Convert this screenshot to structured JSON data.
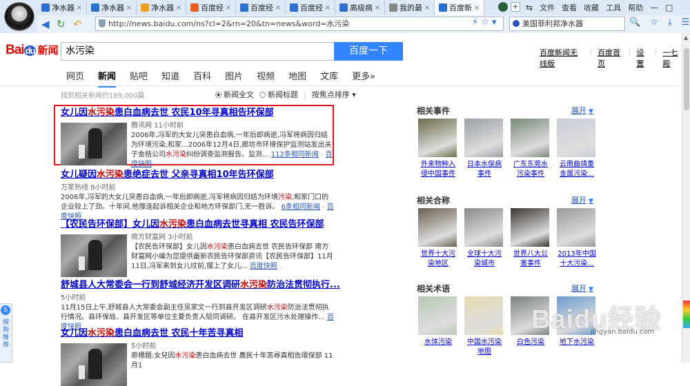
{
  "browser": {
    "tabs": [
      {
        "label": "净水器",
        "color": "#2a6fcf",
        "active": false
      },
      {
        "label": "净水器",
        "color": "#2a6fcf",
        "active": false
      },
      {
        "label": "净水器",
        "color": "#f0a020",
        "active": false
      },
      {
        "label": "百度经",
        "color": "#e85d23",
        "active": false
      },
      {
        "label": "百度经",
        "color": "#2a6fcf",
        "active": false
      },
      {
        "label": "百度经",
        "color": "#2a6fcf",
        "active": false
      },
      {
        "label": "高级病",
        "color": "#2a6fcf",
        "active": false
      },
      {
        "label": "我的最",
        "color": "#888888",
        "active": false
      },
      {
        "label": "百度新",
        "color": "#2a6fcf",
        "active": true
      }
    ],
    "menus": [
      "文件",
      "查看",
      "收藏",
      "工具",
      "帮助"
    ],
    "url": "http://news.baidu.com/ns?cl=2&rn=20&tn=news&word=水污染",
    "search_value": "美国菲利邦净水器"
  },
  "baidu": {
    "logo_main": "Bai",
    "logo_du": "du",
    "logo_news": "新闻",
    "query": "水污染",
    "search_button": "百度一下",
    "top_links": [
      "百度新闻无线版",
      "百度首页",
      "设置",
      "一七殿"
    ],
    "tabs": [
      "网页",
      "新闻",
      "贴吧",
      "知道",
      "百科",
      "图片",
      "视频",
      "地图",
      "文库",
      "更多»"
    ],
    "selected_tab": "新闻",
    "result_count": "找到相关新闻约189,000篇",
    "sort": {
      "fulltext": "新闻全文",
      "title": "新闻标题",
      "by_time": "按焦点排序"
    }
  },
  "results": [
    {
      "title_pre": "女儿因",
      "title_hl": "水污染",
      "title_post": "患白血病去世 农民10年寻真相告环保部",
      "source": "腾讯网  11小时前",
      "body": "2006年,冯军的大女儿突患白血病,一年后即病逝,冯军将病因归结为环境污染,和家...2006年12月4日,廊坊市环境保护监测站发出关于金桔公司",
      "body_hl": "水污染",
      "body_tail": "纠纷调查监测报告。监测...",
      "more": "112条相同新闻",
      "cache": "百度快照"
    },
    {
      "title_pre": "女儿疑因",
      "title_hl": "水污染",
      "title_post": "患绝症去世 父亲寻真相10年告环保部",
      "source": "万家热线  8小时前",
      "body": "2006年,冯军的大女儿突患白血病,一年后即病逝,冯军将病因归结为环境",
      "body_hl": "污染",
      "body_tail": ",和家门口的企业较上了劲。十年间,他搜连起诉相关企业和地方环保部门,无一胜诉。",
      "more": "6条相同新闻",
      "cache": "百度快照"
    },
    {
      "title_pre": "【农民告环保部】女儿因",
      "title_hl": "水污染",
      "title_post": "患白血病去世寻真相 农民告环保部",
      "source": "南方财富网  3小时前",
      "body": "【农民告环保部】女儿因",
      "body_hl": "水污染",
      "body_tail": "患白血病去世 农民告环保部 南方财富网小编为您提供最新农民告环保部资讯【农民告环保部】11月11日,冯军来到女儿坟前,摆上了女儿...",
      "more": "",
      "cache": "百度快照"
    },
    {
      "title_pre": "舒城县人大常委会一行到舒城经济开发区调研",
      "title_hl": "水污染",
      "title_post": "防治法贯彻执行...",
      "source": "5小时前",
      "body": "11月15日上午,舒城县人大常委会副主任吴家文一行到县开发区调研",
      "body_hl": "水污染",
      "body_tail": "防治法贯彻执行情况。县环保局、县开发区等单位主要负责人陪同调研。 在县开发区污水处理操作...",
      "more": "",
      "cache": "百度快照"
    },
    {
      "title_pre": "女儿因",
      "title_hl": "水污染",
      "title_post": "患白血病去世 农民十年苦寻真相",
      "source": "5小时前",
      "body": "原標題:女兒因",
      "body_hl": "水污染",
      "body_tail": "患白血病去世 農民十年苦尋真相告環保部 11月1",
      "more": "",
      "cache": ""
    }
  ],
  "sidebar": {
    "expand_label": "展开",
    "sections": [
      {
        "title": "相关事件",
        "items": [
          {
            "label": "外来物种入侵中国事件",
            "color": "#6b6b4a"
          },
          {
            "label": "日本水俣病事件",
            "color": "#9aa0a6"
          },
          {
            "label": "广东东莞水污染事件",
            "color": "#7a8a7a"
          },
          {
            "label": "云南曲靖重金属污染...",
            "color": "#c9ced6"
          }
        ]
      },
      {
        "title": "相关合称",
        "items": [
          {
            "label": "世界十大污染地区",
            "color": "#6a6050"
          },
          {
            "label": "全球十大污染城市",
            "color": "#8a8a8a"
          },
          {
            "label": "世界八大公害事件",
            "color": "#3a3530"
          },
          {
            "label": "2013年中国十大污染...",
            "color": "#9a9a9a"
          }
        ]
      },
      {
        "title": "相关术语",
        "items": [
          {
            "label": "水体污染",
            "color": "#b7c9b5"
          },
          {
            "label": "中国水污染地图",
            "color": "#e8dcb0"
          },
          {
            "label": "白色污染",
            "color": "#7a8080"
          },
          {
            "label": "地下水污染",
            "color": "#6a9bd0"
          }
        ]
      }
    ]
  },
  "side_widget": {
    "label": "搜狗推荐"
  },
  "watermark": {
    "main": "Baidu经验",
    "sub": "jingyan.baidu.com"
  }
}
